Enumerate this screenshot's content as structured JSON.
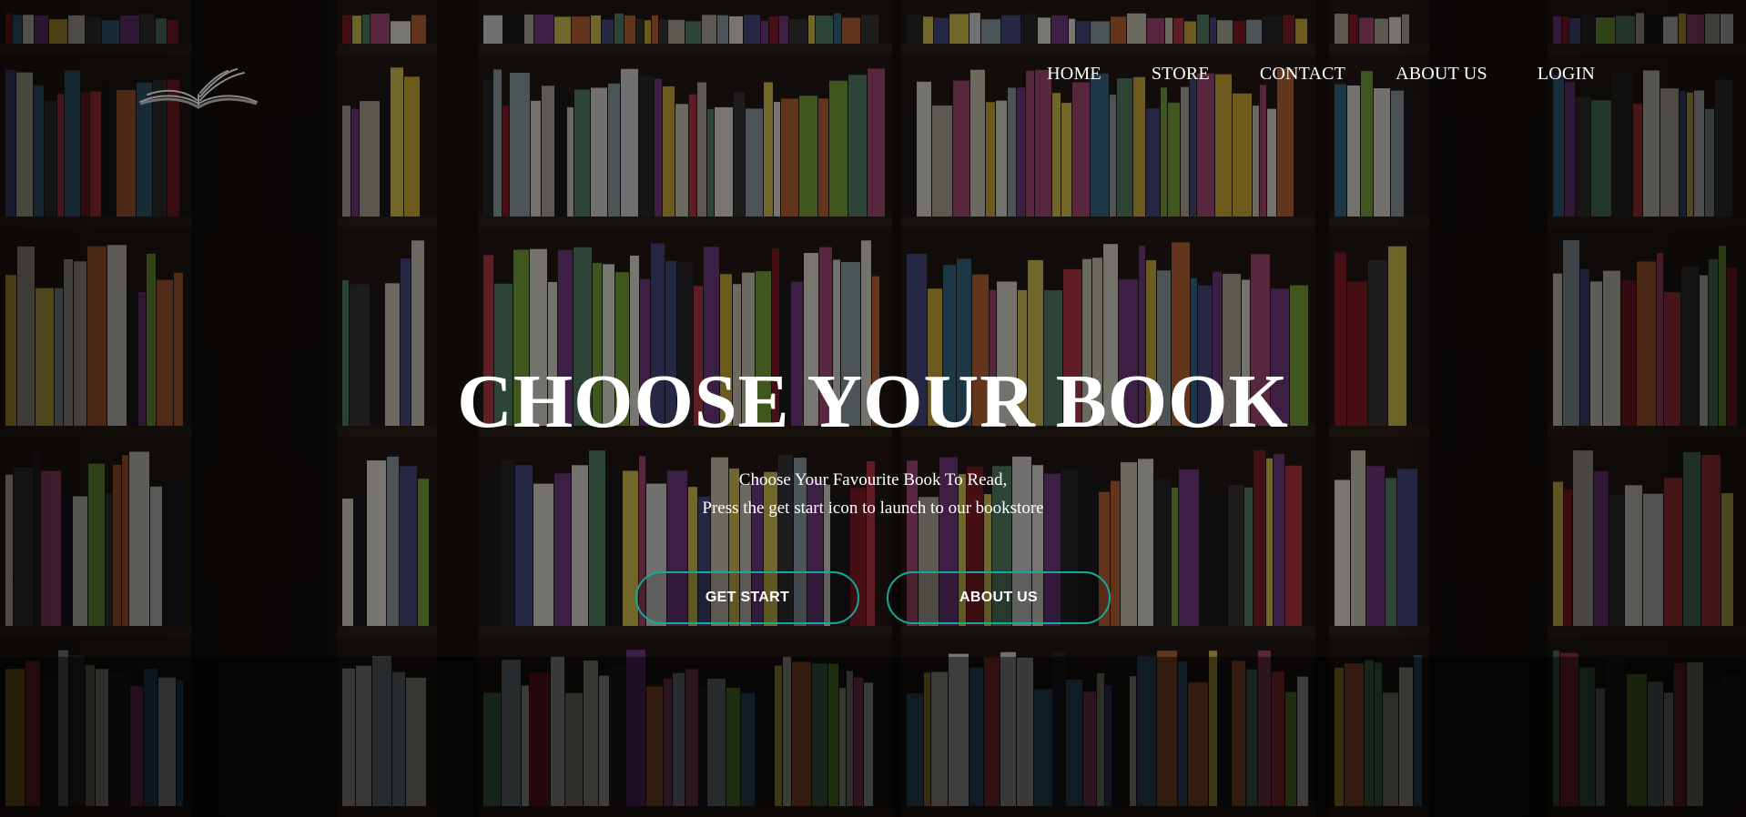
{
  "brand": {
    "logo_icon": "open-book-icon",
    "logo_color": "#8a8a8a"
  },
  "nav": {
    "items": [
      {
        "label": "HOME"
      },
      {
        "label": "STORE"
      },
      {
        "label": "CONTACT"
      },
      {
        "label": "ABOUT US"
      },
      {
        "label": "LOGIN"
      }
    ]
  },
  "hero": {
    "title": "CHOOSE YOUR BOOK",
    "subtitle_line1": "Choose Your Favourite Book To Read,",
    "subtitle_line2": "Press the get start icon to launch to our bookstore"
  },
  "buttons": {
    "get_start": "GET START",
    "about_us": "ABOUT US"
  },
  "colors": {
    "accent": "#14a99a",
    "text": "#ffffff",
    "overlay": "#000000"
  }
}
